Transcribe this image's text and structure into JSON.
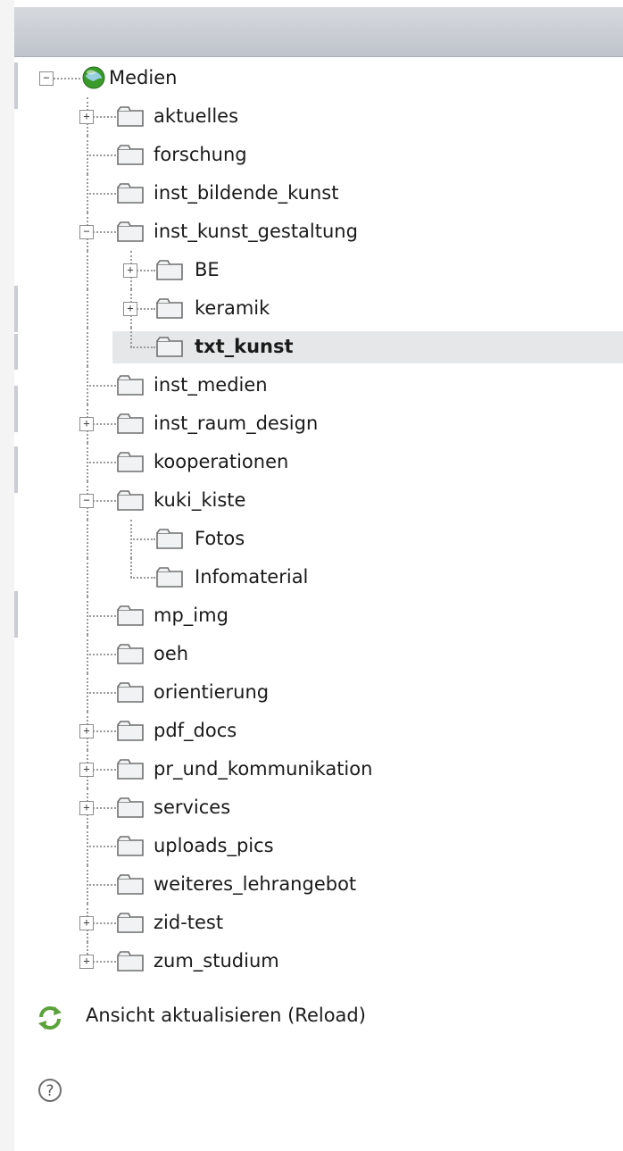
{
  "header": {
    "title": ""
  },
  "tree": {
    "root": {
      "label": "Medien",
      "icon": "globe-icon",
      "toggle": "minus"
    },
    "rows": [
      {
        "label": "aktuelles",
        "level": 1,
        "toggle": "plus",
        "last": false
      },
      {
        "label": "forschung",
        "level": 1,
        "toggle": "none",
        "last": false
      },
      {
        "label": "inst_bildende_kunst",
        "level": 1,
        "toggle": "none",
        "last": false
      },
      {
        "label": "inst_kunst_gestaltung",
        "level": 1,
        "toggle": "minus",
        "last": false
      },
      {
        "label": "BE",
        "level": 2,
        "toggle": "plus",
        "last": false
      },
      {
        "label": "keramik",
        "level": 2,
        "toggle": "plus",
        "last": false
      },
      {
        "label": "txt_kunst",
        "level": 2,
        "toggle": "none",
        "last": true,
        "selected": true
      },
      {
        "label": "inst_medien",
        "level": 1,
        "toggle": "none",
        "last": false
      },
      {
        "label": "inst_raum_design",
        "level": 1,
        "toggle": "plus",
        "last": false
      },
      {
        "label": "kooperationen",
        "level": 1,
        "toggle": "none",
        "last": false
      },
      {
        "label": "kuki_kiste",
        "level": 1,
        "toggle": "minus",
        "last": false
      },
      {
        "label": "Fotos",
        "level": 2,
        "toggle": "none",
        "last": false
      },
      {
        "label": "Infomaterial",
        "level": 2,
        "toggle": "none",
        "last": true
      },
      {
        "label": "mp_img",
        "level": 1,
        "toggle": "none",
        "last": false
      },
      {
        "label": "oeh",
        "level": 1,
        "toggle": "none",
        "last": false
      },
      {
        "label": "orientierung",
        "level": 1,
        "toggle": "none",
        "last": false
      },
      {
        "label": "pdf_docs",
        "level": 1,
        "toggle": "plus",
        "last": false
      },
      {
        "label": "pr_und_kommunikation",
        "level": 1,
        "toggle": "plus",
        "last": false
      },
      {
        "label": "services",
        "level": 1,
        "toggle": "plus",
        "last": false
      },
      {
        "label": "uploads_pics",
        "level": 1,
        "toggle": "none",
        "last": false
      },
      {
        "label": "weiteres_lehrangebot",
        "level": 1,
        "toggle": "none",
        "last": false
      },
      {
        "label": "zid-test",
        "level": 1,
        "toggle": "plus",
        "last": false
      },
      {
        "label": "zum_studium",
        "level": 1,
        "toggle": "plus",
        "last": true
      }
    ]
  },
  "reload": {
    "label": "Ansicht aktualisieren (Reload)",
    "icon": "refresh-icon"
  },
  "help": {
    "icon": "help-icon",
    "glyph": "?"
  },
  "colors": {
    "folder_fill": "#f1f2f3",
    "folder_stroke": "#6f6f6f",
    "globe_green": "#3a9a2a",
    "reload_green": "#5aa23a",
    "selection": "#e6e7e9"
  }
}
